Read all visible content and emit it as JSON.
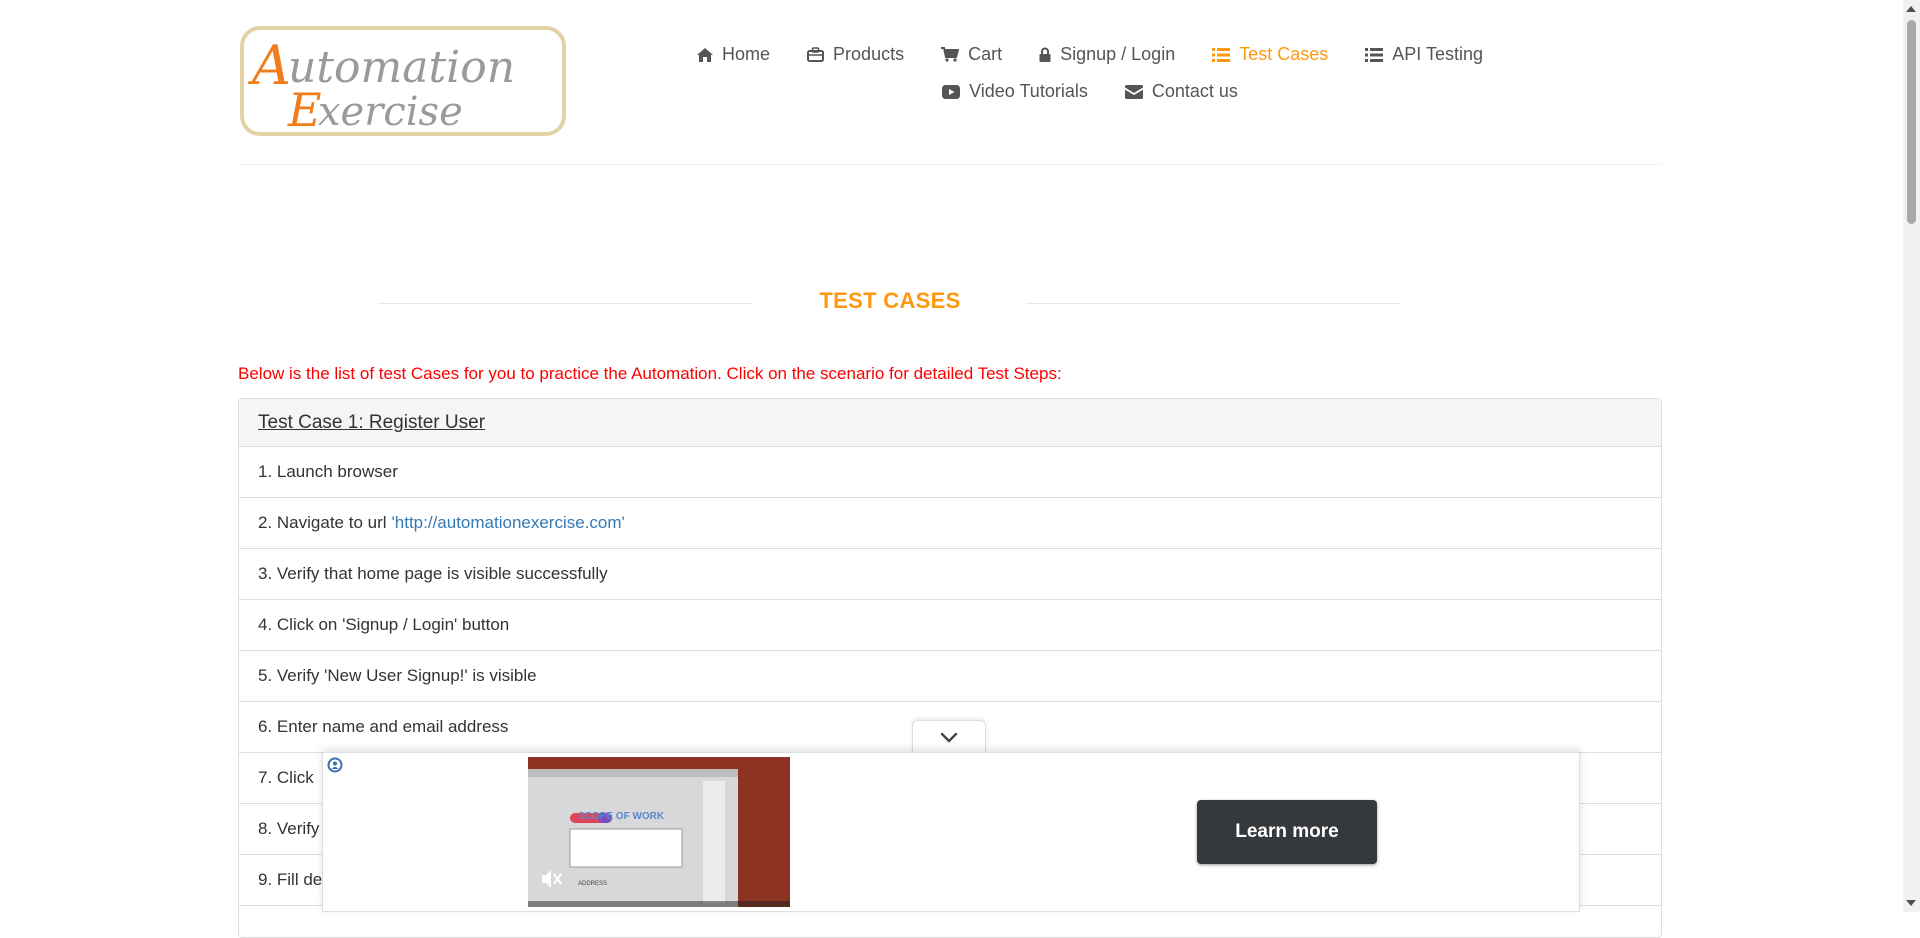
{
  "logo": {
    "line1_initial": "A",
    "line1_rest": "utomation",
    "line2_initial": "E",
    "line2_rest": "xercise"
  },
  "nav": {
    "items": [
      {
        "label": "Home",
        "icon": "home-icon"
      },
      {
        "label": "Products",
        "icon": "briefcase-icon"
      },
      {
        "label": "Cart",
        "icon": "cart-icon"
      },
      {
        "label": "Signup / Login",
        "icon": "lock-icon"
      },
      {
        "label": "Test Cases",
        "icon": "list-icon",
        "active": true
      },
      {
        "label": "API Testing",
        "icon": "list-icon"
      },
      {
        "label": "Video Tutorials",
        "icon": "youtube-icon"
      },
      {
        "label": "Contact us",
        "icon": "envelope-icon"
      }
    ]
  },
  "page": {
    "title": "TEST CASES",
    "intro": "Below is the list of test Cases for you to practice the Automation. Click on the scenario for detailed Test Steps:"
  },
  "test_case": {
    "title": "Test Case 1: Register User",
    "steps": [
      "1. Launch browser",
      "2. Navigate to url",
      "3. Verify that home page is visible successfully",
      "4. Click on 'Signup / Login' button",
      "5. Verify 'New User Signup!' is visible",
      "6. Enter name and email address",
      "7. Click",
      "8. Verify",
      "9. Fill de"
    ],
    "url": "'http://automationexercise.com'"
  },
  "ad": {
    "button_label": "Learn more",
    "video_heading": "SCOPE OF WORK",
    "video_address": "ADDRESS"
  },
  "colors": {
    "accent": "#fe980f",
    "intro_red": "#fe0000",
    "link": "#337ab7"
  }
}
